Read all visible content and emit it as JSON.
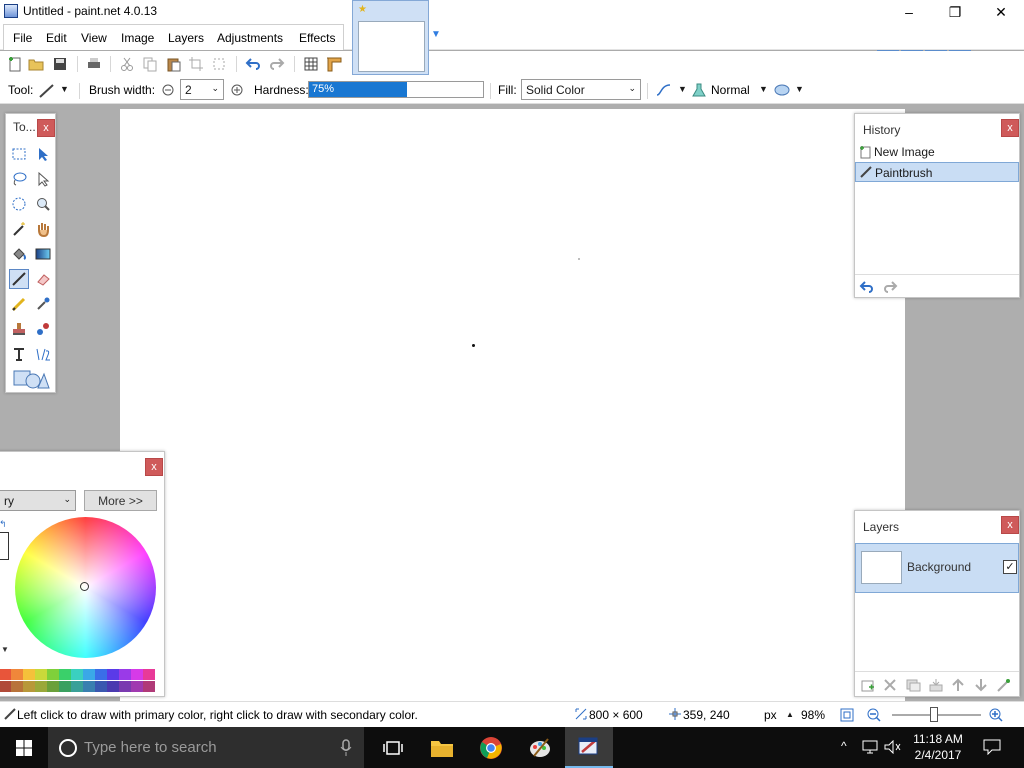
{
  "window": {
    "title": "Untitled - paint.net 4.0.13",
    "minimize": "–",
    "maximize": "❐",
    "close": "✕"
  },
  "menu": [
    "File",
    "Edit",
    "View",
    "Image",
    "Layers",
    "Adjustments",
    "Effects"
  ],
  "tool_options": {
    "tool_label": "Tool:",
    "brush_width_label": "Brush width:",
    "brush_width_value": "2",
    "hardness_label": "Hardness:",
    "hardness_value": "75%",
    "hardness_fraction": 0.75,
    "fill_label": "Fill:",
    "fill_value": "Solid Color",
    "blend_mode": "Normal"
  },
  "tools_panel": {
    "title": "To...",
    "close": "x"
  },
  "history_panel": {
    "title": "History",
    "close": "x",
    "items": [
      {
        "label": "New Image",
        "icon": "new-image-icon",
        "selected": false
      },
      {
        "label": "Paintbrush",
        "icon": "paintbrush-icon",
        "selected": true
      }
    ]
  },
  "colors_panel": {
    "close": "x",
    "mode_value": "ry",
    "more_button": "More >>",
    "palette_row1": [
      "#e8553a",
      "#f0873a",
      "#f5c13a",
      "#c9d93a",
      "#7fd03a",
      "#3ad06a",
      "#3ad0c0",
      "#3aa8e8",
      "#3a6ee8",
      "#5a3ae8",
      "#9a3ae8",
      "#d63ae8",
      "#e83a98"
    ],
    "palette_row2": [
      "#b04a38",
      "#b8733a",
      "#b8983a",
      "#9aa83a",
      "#6aa03a",
      "#3aa060",
      "#3aa098",
      "#3a80b0",
      "#3a58b0",
      "#4a3ab0",
      "#7a3ab0",
      "#a03ab0",
      "#b03a78"
    ]
  },
  "layers_panel": {
    "title": "Layers",
    "close": "x",
    "layers": [
      {
        "name": "Background",
        "visible": true
      }
    ]
  },
  "status": {
    "hint": "Left click to draw with primary color, right click to draw with secondary color.",
    "image_size": "800 × 600",
    "cursor_pos": "359, 240",
    "units": "px",
    "zoom": "98%"
  },
  "taskbar": {
    "search_placeholder": "Type here to search",
    "time": "11:18 AM",
    "date": "2/4/2017"
  }
}
